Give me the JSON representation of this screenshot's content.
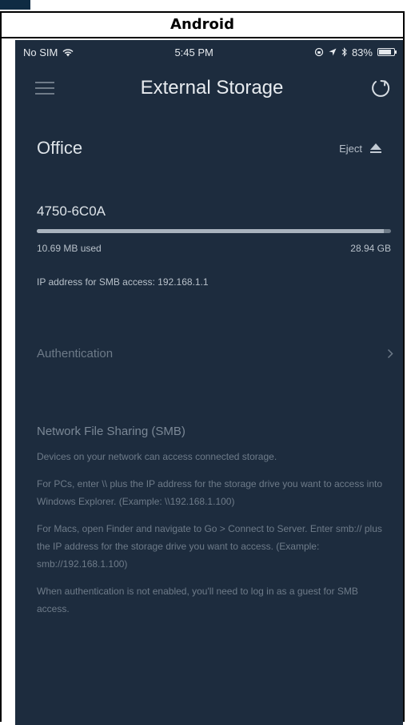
{
  "platform": "Android",
  "status_bar": {
    "carrier": "No SIM",
    "time": "5:45 PM",
    "battery_percent": "83%",
    "battery_level": 0.83
  },
  "nav": {
    "title": "External Storage"
  },
  "location": {
    "name": "Office",
    "eject_label": "Eject"
  },
  "drive": {
    "name": "4750-6C0A",
    "used_label": "10.69 MB used",
    "capacity_label": "28.94 GB",
    "used_fraction": 0.98
  },
  "ip_line": "IP address for SMB access: 192.168.1.1",
  "authentication_label": "Authentication",
  "smb": {
    "title": "Network File Sharing (SMB)",
    "paragraphs": [
      "Devices on your network can access connected storage.",
      "For PCs, enter \\\\ plus the IP address for the storage drive you want to access into Windows Explorer. (Example: \\\\192.168.1.100)",
      "For Macs, open Finder and navigate to Go > Connect to Server. Enter smb:// plus the IP address for the storage drive you want to access. (Example: smb://192.168.1.100)",
      "When authentication is not enabled, you'll need to log in as a guest for SMB access."
    ]
  },
  "colors": {
    "app_background": "#1d2c3e",
    "corner_tab": "#0f2b43"
  }
}
